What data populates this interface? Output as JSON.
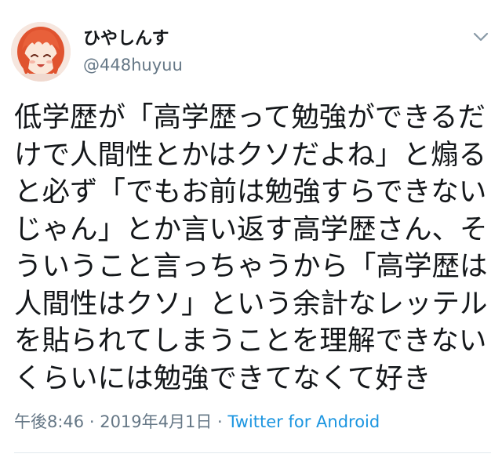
{
  "tweet": {
    "author": {
      "display_name": "ひやしんす",
      "handle": "@448huyuu"
    },
    "text_lines": [
      "低学歴が「高学歴って勉強ができるだ",
      "けで人間性とかはクソだよね」と煽る",
      "と必ず「でもお前は勉強すらできない",
      "じゃん」とか言い返す高学歴さん、そ",
      "ういうこと言っちゃうから「高学歴は",
      "人間性はクソ」という余計なレッテル",
      "を貼られてしまうことを理解できない",
      "くらいには勉強できてなくて好き"
    ],
    "time": "午後8:46",
    "separator": " · ",
    "date": "2019年4月1日",
    "source": "Twitter for Android"
  },
  "icons": {
    "avatar": "anime-avatar",
    "menu": "chevron-down-icon"
  },
  "colors": {
    "text": "#14171a",
    "secondary": "#657786",
    "link": "#1b95e0",
    "divider": "#e1e8ed",
    "avatar_hair": "#e0532f"
  }
}
